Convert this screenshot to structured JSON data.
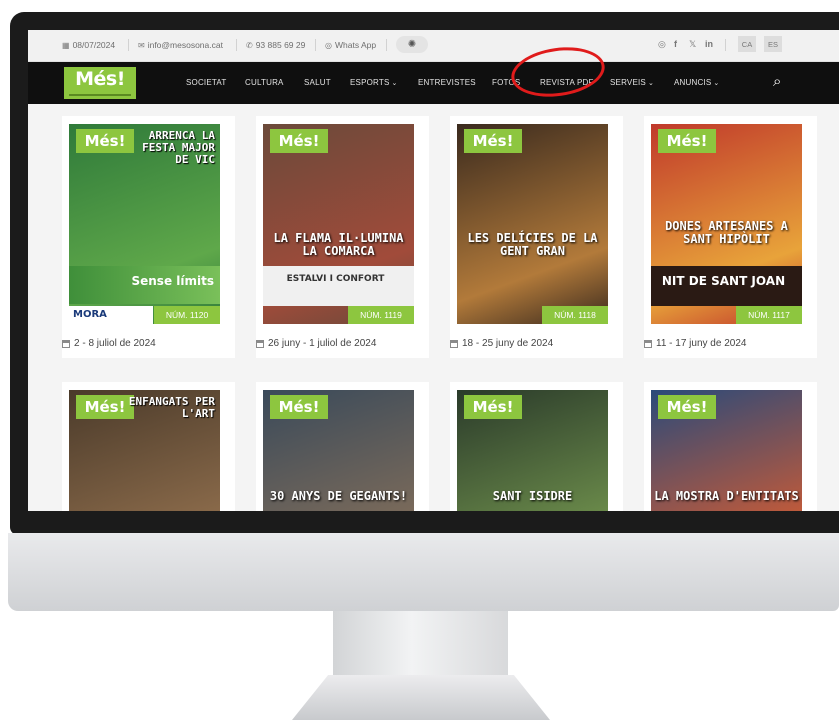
{
  "topbar": {
    "date": "08/07/2024",
    "email": "info@mesosona.cat",
    "phone": "93 885 69 29",
    "whatsapp": "Whats App",
    "languages": [
      "CA",
      "ES"
    ]
  },
  "nav": {
    "logo": "Més!",
    "items": [
      "SOCIETAT",
      "CULTURA",
      "SALUT",
      "ESPORTS",
      "ENTREVISTES",
      "FOTOS",
      "REVISTA PDF",
      "SERVEIS",
      "ANUNCIS"
    ]
  },
  "issues": [
    {
      "headline": "ARRENCA LA FESTA MAJOR DE VIC",
      "banner": "Sense límits",
      "ad": "MORA",
      "number": "NÚM. 1120",
      "date": "2 - 8 juliol de 2024",
      "colors": [
        "#2f7a3a",
        "#5fa84a"
      ]
    },
    {
      "headline": "LA FLAMA IL·LUMINA LA COMARCA",
      "banner": "ESTALVI I CONFORT",
      "ad": "",
      "number": "NÚM. 1119",
      "date": "26 juny - 1 juliol de 2024",
      "colors": [
        "#6b4a3a",
        "#a14b3a"
      ]
    },
    {
      "headline": "LES DELÍCIES DE LA GENT GRAN",
      "banner": "",
      "ad": "",
      "number": "NÚM. 1118",
      "date": "18 - 25 juny de 2024",
      "colors": [
        "#3a2a1e",
        "#b27a3a"
      ]
    },
    {
      "headline": "DONES ARTESANES A SANT HIPÒLIT",
      "banner": "NIT DE SANT JOAN",
      "ad": "",
      "number": "NÚM. 1117",
      "date": "11 - 17 juny de 2024",
      "colors": [
        "#c0392b",
        "#e8a33a"
      ]
    },
    {
      "headline": "ENFANGATS PER L'ART",
      "banner": "",
      "ad": "",
      "number": "",
      "date": "",
      "colors": [
        "#4a3a2a",
        "#8a6a4a"
      ]
    },
    {
      "headline": "30 ANYS DE GEGANTS!",
      "banner": "",
      "ad": "",
      "number": "",
      "date": "",
      "colors": [
        "#3a4a5a",
        "#7a6a5a"
      ]
    },
    {
      "headline": "SANT ISIDRE",
      "banner": "",
      "ad": "",
      "number": "",
      "date": "",
      "colors": [
        "#2a3a2a",
        "#6a8a4a"
      ]
    },
    {
      "headline": "LA MOSTRA D'ENTITATS",
      "banner": "",
      "ad": "",
      "number": "",
      "date": "",
      "colors": [
        "#2a4a7a",
        "#c05a3a"
      ]
    }
  ],
  "colors": {
    "brand_green": "#8dc63f",
    "nav_bg": "#0f0f0f",
    "highlight": "#e01b1b"
  }
}
